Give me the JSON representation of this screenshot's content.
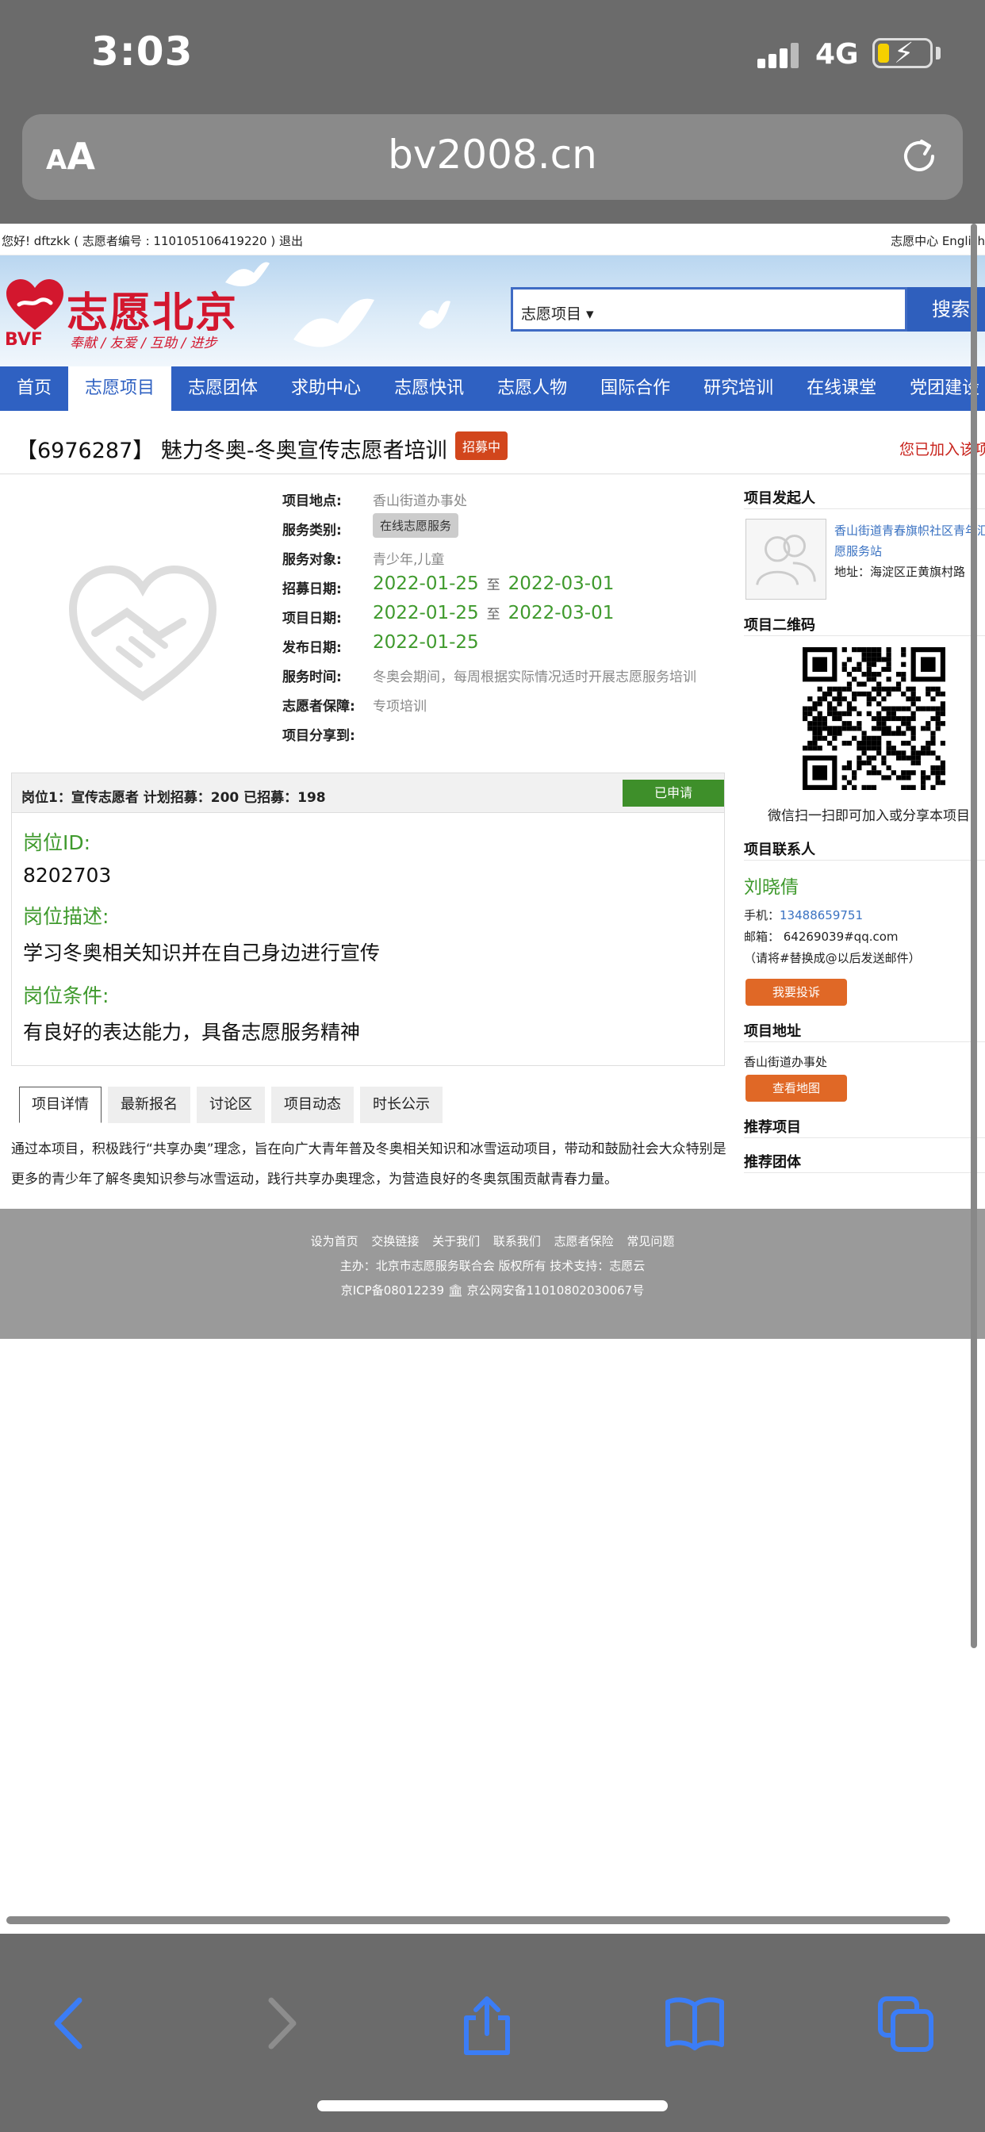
{
  "status": {
    "time": "3:03",
    "network": "4G"
  },
  "browser": {
    "text_size_label_small": "A",
    "text_size_label_large": "A",
    "domain": "bv2008.cn"
  },
  "topbar": {
    "greeting": "您好! dftzkk ( 志愿者编号 : 110105106419220 )   退出",
    "right": "志愿中心  English"
  },
  "header": {
    "logo_text": "志愿北京",
    "logo_abbr": "BVF",
    "logo_slogan": "奉献 / 友爱 / 互助 / 进步",
    "search_category": "志愿项目 ▾",
    "search_button": "搜索"
  },
  "nav": [
    "首页",
    "志愿项目",
    "志愿团体",
    "求助中心",
    "志愿快讯",
    "志愿人物",
    "国际合作",
    "研究培训",
    "在线课堂",
    "党团建设"
  ],
  "project": {
    "title": "【6976287】 魅力冬奥-冬奥宣传志愿者培训",
    "status_badge": "招募中",
    "joined_text": "您已加入该项目",
    "location_label": "项目地点:",
    "location": "香山街道办事处",
    "category_label": "服务类别:",
    "category": "在线志愿服务",
    "target_label": "服务对象:",
    "target": "青少年,儿童",
    "recruit_label": "招募日期:",
    "recruit_start": "2022-01-25",
    "recruit_end": "2022-03-01",
    "period_label": "项目日期:",
    "period_start": "2022-01-25",
    "period_end": "2022-03-01",
    "publish_label": "发布日期:",
    "publish": "2022-01-25",
    "time_label": "服务时间:",
    "time": "冬奥会期间，每周根据实际情况适时开展志愿服务培训",
    "guarantee_label": "志愿者保障:",
    "guarantee": "专项培训",
    "share_label": "项目分享到:",
    "to": "至"
  },
  "position": {
    "header": "岗位1：宣传志愿者    计划招募：200    已招募：198",
    "applied": "已申请",
    "id_label": "岗位ID:",
    "id": "8202703",
    "desc_label": "岗位描述:",
    "desc": "学习冬奥相关知识并在自己身边进行宣传",
    "req_label": "岗位条件:",
    "req": "有良好的表达能力，具备志愿服务精神"
  },
  "tabs": [
    "项目详情",
    "最新报名",
    "讨论区",
    "项目动态",
    "时长公示"
  ],
  "description": "通过本项目，积极践行“共享办奥”理念，旨在向广大青年普及冬奥相关知识和冰雪运动项目，带动和鼓励社会大众特别是更多的青少年了解冬奥知识参与冰雪运动，践行共享办奥理念，为营造良好的冬奥氛围贡献青春力量。",
  "sidebar": {
    "initiator_title": "项目发起人",
    "org_name": "香山街道青春旗帜社区青年汇志愿服务站",
    "org_address": "地址：海淀区正黄旗村路",
    "qr_title": "项目二维码",
    "qr_note": "微信扫一扫即可加入或分享本项目",
    "contact_title": "项目联系人",
    "contact_name": "刘晓倩",
    "phone_label": "手机：",
    "phone": "13488659751",
    "email": "邮箱： 64269039#qq.com",
    "email_note": "（请将#替换成@以后发送邮件）",
    "complain": "我要投诉",
    "address_title": "项目地址",
    "address": "香山街道办事处",
    "map": "查看地图",
    "recommend_title": "推荐项目",
    "recommend_group_title": "推荐团体"
  },
  "footer": {
    "links": "设为首页  交换链接  关于我们  联系我们  志愿者保险  常见问题",
    "host": "主办：北京市志愿服务联合会 版权所有  技术支持：志愿云",
    "icp": "京ICP备08012239    🏛 京公网安备11010802030067号"
  },
  "colors": {
    "nav": "#2f61c2",
    "green": "#3f9a2d",
    "red": "#d3172e",
    "orange": "#e06826"
  }
}
